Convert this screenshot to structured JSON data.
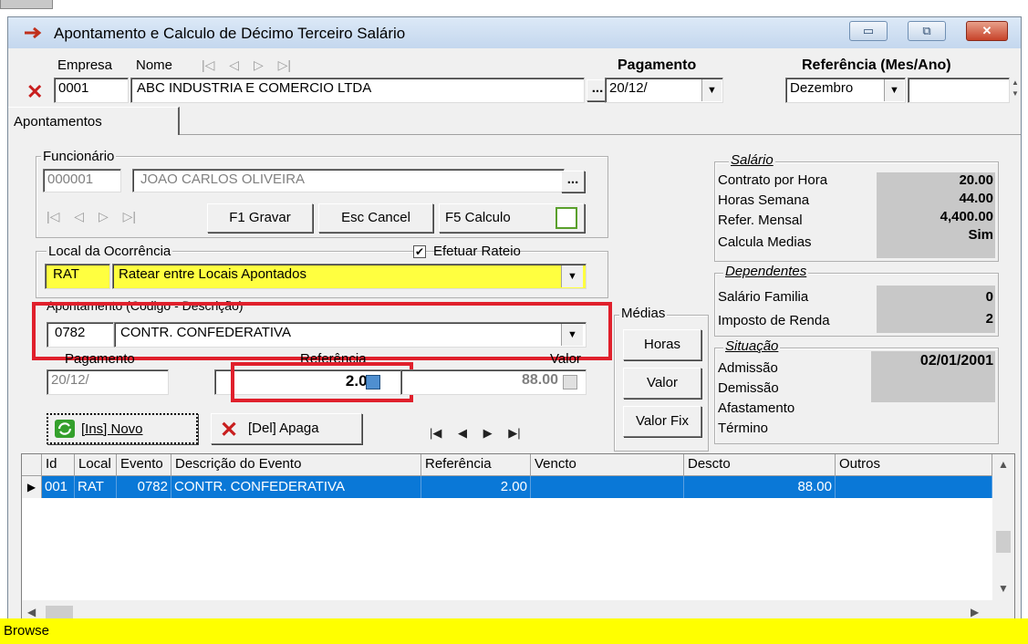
{
  "window": {
    "title": "Apontamento e Calculo de Décimo Terceiro Salário",
    "controls": [
      "▭",
      "⧉",
      "✕"
    ]
  },
  "header": {
    "empresa_label": "Empresa",
    "nome_label": "Nome",
    "nav_arrows": [
      "|◁",
      "◁",
      "▷",
      "▷|"
    ],
    "empresa_code": "0001",
    "empresa_name": "ABC INDUSTRIA E COMERCIO LTDA",
    "ellipsis": "...",
    "pagamento_label": "Pagamento",
    "pagamento_value": "20/12/",
    "referencia_label": "Referência (Mes/Ano)",
    "referencia_month": "Dezembro",
    "referencia_year": ""
  },
  "tabs": [
    {
      "label": "Apontamentos"
    }
  ],
  "funcionario": {
    "title": "Funcionário",
    "code": "000001",
    "name": "JOAO CARLOS OLIVEIRA",
    "ellipsis": "...",
    "nav_arrows": [
      "|◁",
      "◁",
      "▷",
      "▷|"
    ],
    "btn_gravar": "F1 Gravar",
    "btn_cancel": "Esc Cancel",
    "btn_calculo": "F5 Calculo"
  },
  "local": {
    "title": "Local da Ocorrência",
    "rateio_label": "Efetuar Rateio",
    "rateio_checked": true,
    "code": "RAT",
    "description": "Ratear entre Locais Apontados"
  },
  "apontamento": {
    "title": "Apontamento (Codigo - Descrição)",
    "code": "0782",
    "description": "CONTR. CONFEDERATIVA",
    "pagamento_label": "Pagamento",
    "referencia_label": "Referência",
    "valor_label": "Valor",
    "pagamento_value": "20/12/",
    "referencia_value": "2.00",
    "valor_value": "88.00"
  },
  "actions": {
    "novo": "[Ins] Novo",
    "apaga": "[Del] Apaga",
    "record_nav": [
      "|◀",
      "◀",
      "▶",
      "▶|"
    ]
  },
  "medias": {
    "title": "Médias",
    "horas": "Horas",
    "valor": "Valor",
    "valor_fix": "Valor Fix"
  },
  "salario": {
    "title": "Salário",
    "rows": [
      {
        "label": "Contrato por Hora",
        "value": "20.00"
      },
      {
        "label": "Horas Semana",
        "value": "44.00"
      },
      {
        "label": "Refer. Mensal",
        "value": "4,400.00"
      },
      {
        "label": "Calcula Medias",
        "value": "Sim"
      }
    ]
  },
  "dependentes": {
    "title": "Dependentes",
    "rows": [
      {
        "label": "Salário Familia",
        "value": "0"
      },
      {
        "label": "Imposto de Renda",
        "value": "2"
      }
    ]
  },
  "situacao": {
    "title": "Situação",
    "labels": [
      "Admissão",
      "Demissão",
      "Afastamento",
      "Término"
    ],
    "admissao_value": "02/01/2001"
  },
  "grid": {
    "columns": [
      "Id",
      "Local",
      "Evento",
      "Descrição do Evento",
      "Referência",
      "Vencto",
      "Descto",
      "Outros"
    ],
    "rows": [
      {
        "id": "001",
        "local": "RAT",
        "evento": "0782",
        "descricao": "CONTR. CONFEDERATIVA",
        "referencia": "2.00",
        "vencto": "",
        "descto": "88.00",
        "outros": ""
      }
    ]
  },
  "statusbar": {
    "text": "Browse"
  },
  "colors": {
    "selection": "#0a78d7",
    "highlight": "#ffff40",
    "annotation": "#e0202c",
    "status": "#ffff00"
  }
}
